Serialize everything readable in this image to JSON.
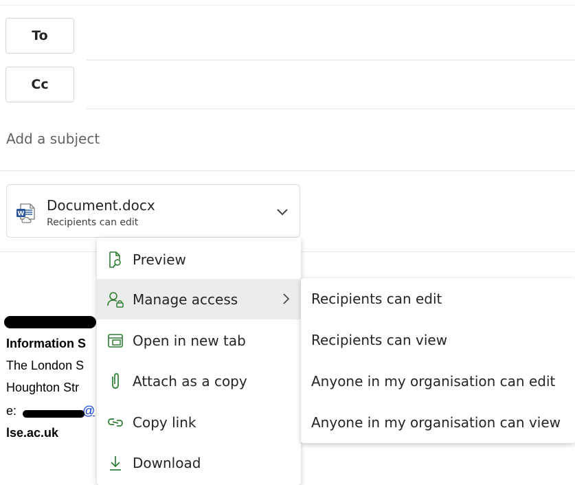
{
  "compose": {
    "to_label": "To",
    "cc_label": "Cc",
    "subject_placeholder": "Add a subject"
  },
  "attachment": {
    "file_name": "Document.docx",
    "permission": "Recipients can edit",
    "icon": "word-document-cloud-icon"
  },
  "signature": {
    "line1": "Information S",
    "line2": "The London S",
    "line3": "Houghton Str",
    "line4_prefix": "e:",
    "line4_link": "@",
    "line5": "lse.ac.uk"
  },
  "context_menu": {
    "items": [
      {
        "label": "Preview",
        "icon": "preview-icon"
      },
      {
        "label": "Manage access",
        "icon": "manage-access-icon"
      },
      {
        "label": "Open in new tab",
        "icon": "open-new-tab-icon"
      },
      {
        "label": "Attach as a copy",
        "icon": "paperclip-icon"
      },
      {
        "label": "Copy link",
        "icon": "link-icon"
      },
      {
        "label": "Download",
        "icon": "download-icon"
      }
    ]
  },
  "submenu": {
    "items": [
      {
        "label": "Recipients can edit"
      },
      {
        "label": "Recipients can view"
      },
      {
        "label": "Anyone in my organisation can edit"
      },
      {
        "label": "Anyone in my organisation can view"
      }
    ]
  },
  "colors": {
    "accent_green": "#2e7d32",
    "link_blue": "#0b3dd9",
    "hover_gray": "#ececec"
  }
}
